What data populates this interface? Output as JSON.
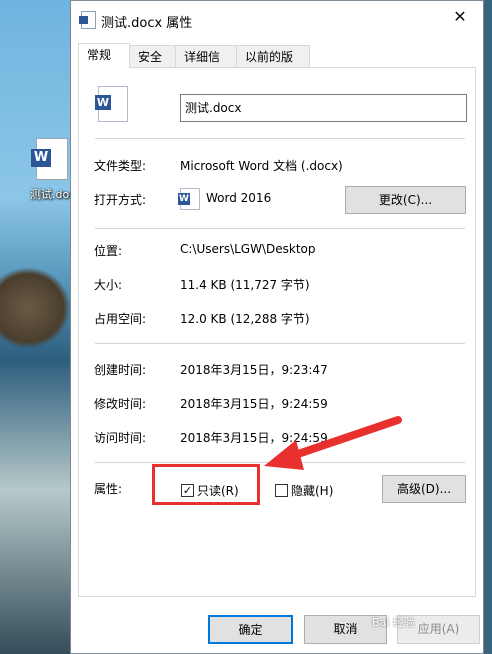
{
  "desktop": {
    "icon_label": "测试.docx"
  },
  "window": {
    "title": "测试.docx 属性",
    "close_glyph": "✕"
  },
  "tabs": [
    {
      "label": "常规"
    },
    {
      "label": "安全"
    },
    {
      "label": "详细信息"
    },
    {
      "label": "以前的版本"
    }
  ],
  "general": {
    "file_name": "测试.docx",
    "file_type_label": "文件类型:",
    "file_type_value": "Microsoft Word 文档 (.docx)",
    "open_with_label": "打开方式:",
    "open_with_value": "Word 2016",
    "change_button": "更改(C)...",
    "location_label": "位置:",
    "location_value": "C:\\Users\\LGW\\Desktop",
    "size_label": "大小:",
    "size_value": "11.4 KB (11,727 字节)",
    "size_on_disk_label": "占用空间:",
    "size_on_disk_value": "12.0 KB (12,288 字节)",
    "created_label": "创建时间:",
    "created_value": "2018年3月15日，9:23:47",
    "modified_label": "修改时间:",
    "modified_value": "2018年3月15日，9:24:59",
    "accessed_label": "访问时间:",
    "accessed_value": "2018年3月15日，9:24:59",
    "attributes_label": "属性:",
    "readonly_label": "只读(R)",
    "readonly_checked": true,
    "hidden_label": "隐藏(H)",
    "hidden_checked": false,
    "advanced_button": "高级(D)..."
  },
  "footer": {
    "ok_button": "确定",
    "cancel_button": "取消",
    "apply_button": "应用(A)"
  },
  "annotation": {
    "color": "#e8312f"
  },
  "watermark": {
    "text": "Bai 经验"
  }
}
